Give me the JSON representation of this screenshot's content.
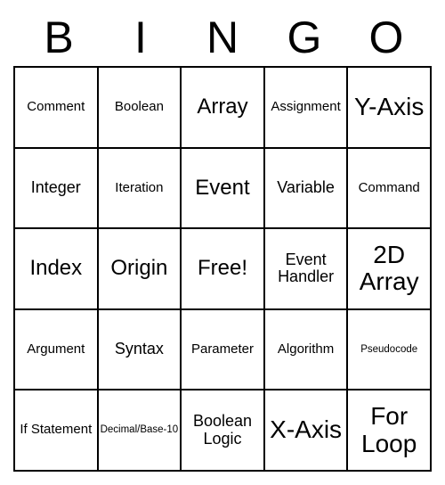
{
  "header": {
    "letters": [
      "B",
      "I",
      "N",
      "G",
      "O"
    ]
  },
  "grid": {
    "rows": [
      [
        {
          "text": "Comment",
          "size": "sm"
        },
        {
          "text": "Boolean",
          "size": "sm"
        },
        {
          "text": "Array",
          "size": "lg"
        },
        {
          "text": "Assignment",
          "size": "sm"
        },
        {
          "text": "Y-Axis",
          "size": "xl"
        }
      ],
      [
        {
          "text": "Integer",
          "size": "md"
        },
        {
          "text": "Iteration",
          "size": "sm"
        },
        {
          "text": "Event",
          "size": "lg"
        },
        {
          "text": "Variable",
          "size": "md"
        },
        {
          "text": "Command",
          "size": "sm"
        }
      ],
      [
        {
          "text": "Index",
          "size": "lg"
        },
        {
          "text": "Origin",
          "size": "lg"
        },
        {
          "text": "Free!",
          "size": "lg"
        },
        {
          "text": "Event Handler",
          "size": "md"
        },
        {
          "text": "2D Array",
          "size": "xl"
        }
      ],
      [
        {
          "text": "Argument",
          "size": "sm"
        },
        {
          "text": "Syntax",
          "size": "md"
        },
        {
          "text": "Parameter",
          "size": "sm"
        },
        {
          "text": "Algorithm",
          "size": "sm"
        },
        {
          "text": "Pseudocode",
          "size": "xs"
        }
      ],
      [
        {
          "text": "If Statement",
          "size": "sm"
        },
        {
          "text": "Decimal/Base-10",
          "size": "xs"
        },
        {
          "text": "Boolean Logic",
          "size": "md"
        },
        {
          "text": "X-Axis",
          "size": "xl"
        },
        {
          "text": "For Loop",
          "size": "xl"
        }
      ]
    ]
  }
}
